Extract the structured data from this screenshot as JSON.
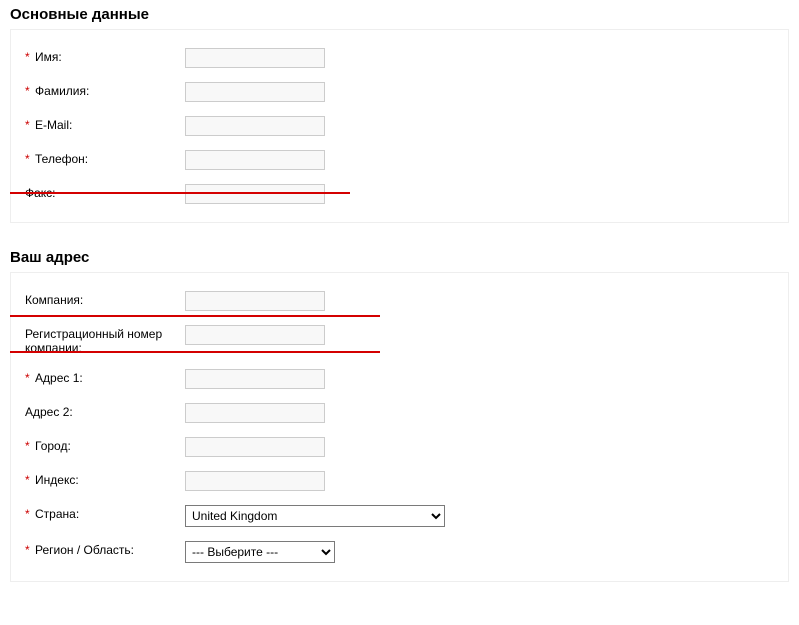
{
  "section1": {
    "title": "Основные данные",
    "fields": {
      "name": {
        "label": "Имя:",
        "required": true
      },
      "surname": {
        "label": "Фамилия:",
        "required": true
      },
      "email": {
        "label": "E-Mail:",
        "required": true
      },
      "phone": {
        "label": "Телефон:",
        "required": true
      },
      "fax": {
        "label": "Факс:",
        "required": false
      }
    }
  },
  "section2": {
    "title": "Ваш адрес",
    "fields": {
      "company": {
        "label": "Компания:",
        "required": false
      },
      "regnum": {
        "label": "Регистрационный номер компании:",
        "required": false
      },
      "address1": {
        "label": "Адрес 1:",
        "required": true
      },
      "address2": {
        "label": "Адрес 2:",
        "required": false
      },
      "city": {
        "label": "Город:",
        "required": true
      },
      "postcode": {
        "label": "Индекс:",
        "required": true
      },
      "country": {
        "label": "Страна:",
        "required": true,
        "value": "United Kingdom"
      },
      "region": {
        "label": "Регион / Область:",
        "required": true,
        "value": "--- Выберите ---"
      }
    }
  }
}
